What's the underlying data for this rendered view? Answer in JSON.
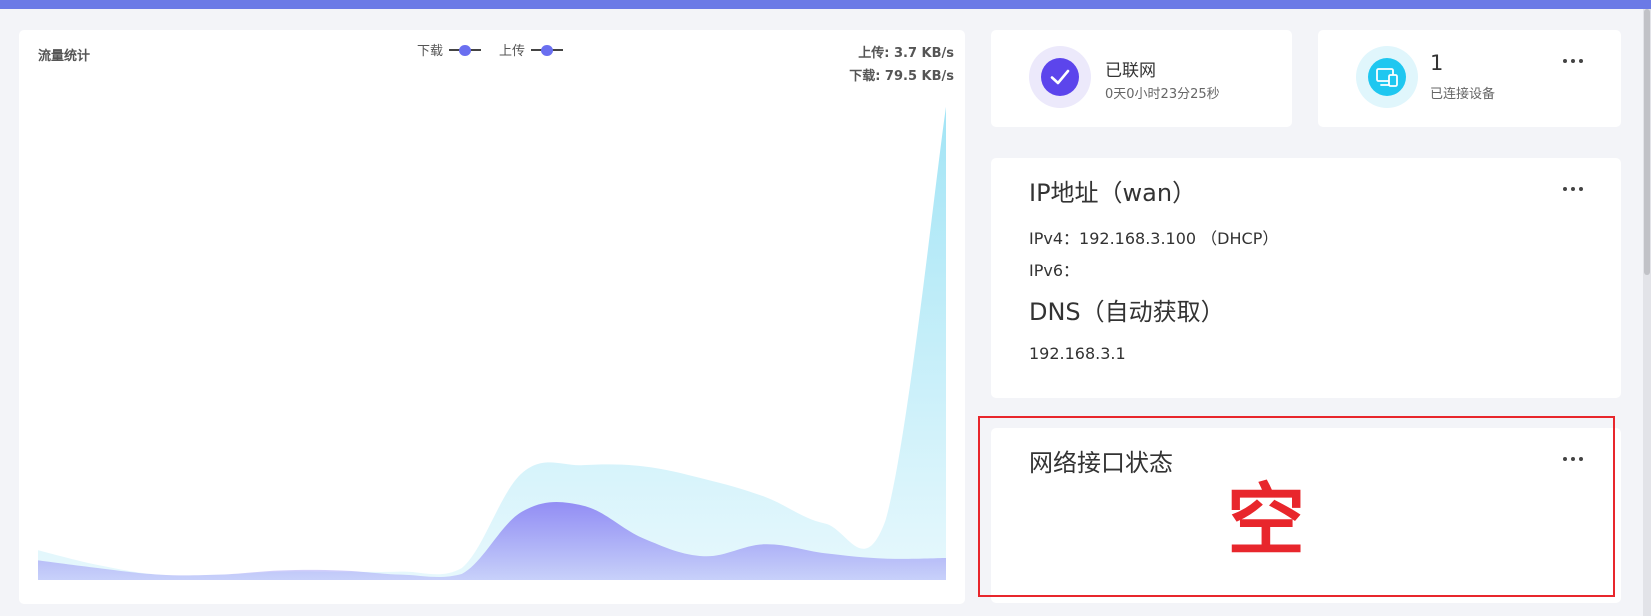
{
  "traffic": {
    "title": "流量统计",
    "legend": {
      "download_label": "下载",
      "upload_label": "上传",
      "download_color": "#6a6ff0",
      "upload_color": "#6a6ff0"
    },
    "upload_rate": "上传: 3.7 KB/s",
    "download_rate": "下载: 79.5 KB/s",
    "colors": {
      "download_fill": "#9ee3f5",
      "upload_fill": "#8f88f4"
    }
  },
  "chart_data": {
    "type": "area",
    "title": "流量统计",
    "series": [
      {
        "name": "下载",
        "values": [
          5.0,
          2.5,
          0.9,
          0.9,
          1.4,
          1.4,
          1.4,
          2.0,
          18.0,
          19.3,
          19.1,
          17.0,
          14.0,
          9.5,
          10.0,
          79.5
        ]
      },
      {
        "name": "上传",
        "values": [
          3.3,
          2.0,
          0.9,
          0.9,
          1.6,
          1.6,
          0.9,
          1.0,
          11.5,
          12.5,
          7.0,
          4.0,
          6.0,
          4.5,
          3.6,
          3.7
        ]
      }
    ],
    "ylim": [
      0,
      82
    ],
    "grid": false,
    "legend_position": "top-center"
  },
  "status": {
    "online_title": "已联网",
    "online_duration": "0天0小时23分25秒",
    "devices_count": "1",
    "devices_label": "已连接设备",
    "online_icon_color": "#5c45ec",
    "devices_icon_color": "#1fc7f0"
  },
  "ip": {
    "title": "IP地址（wan）",
    "ipv4_label": "IPv4：",
    "ipv4_value": "192.168.3.100 （DHCP）",
    "ipv6_label": "IPv6：",
    "dns_title": "DNS（自动获取）",
    "dns_value": "192.168.3.1"
  },
  "interfaces": {
    "title": "网络接口状态",
    "annotation": "空",
    "annotation_color": "#e8262c"
  }
}
